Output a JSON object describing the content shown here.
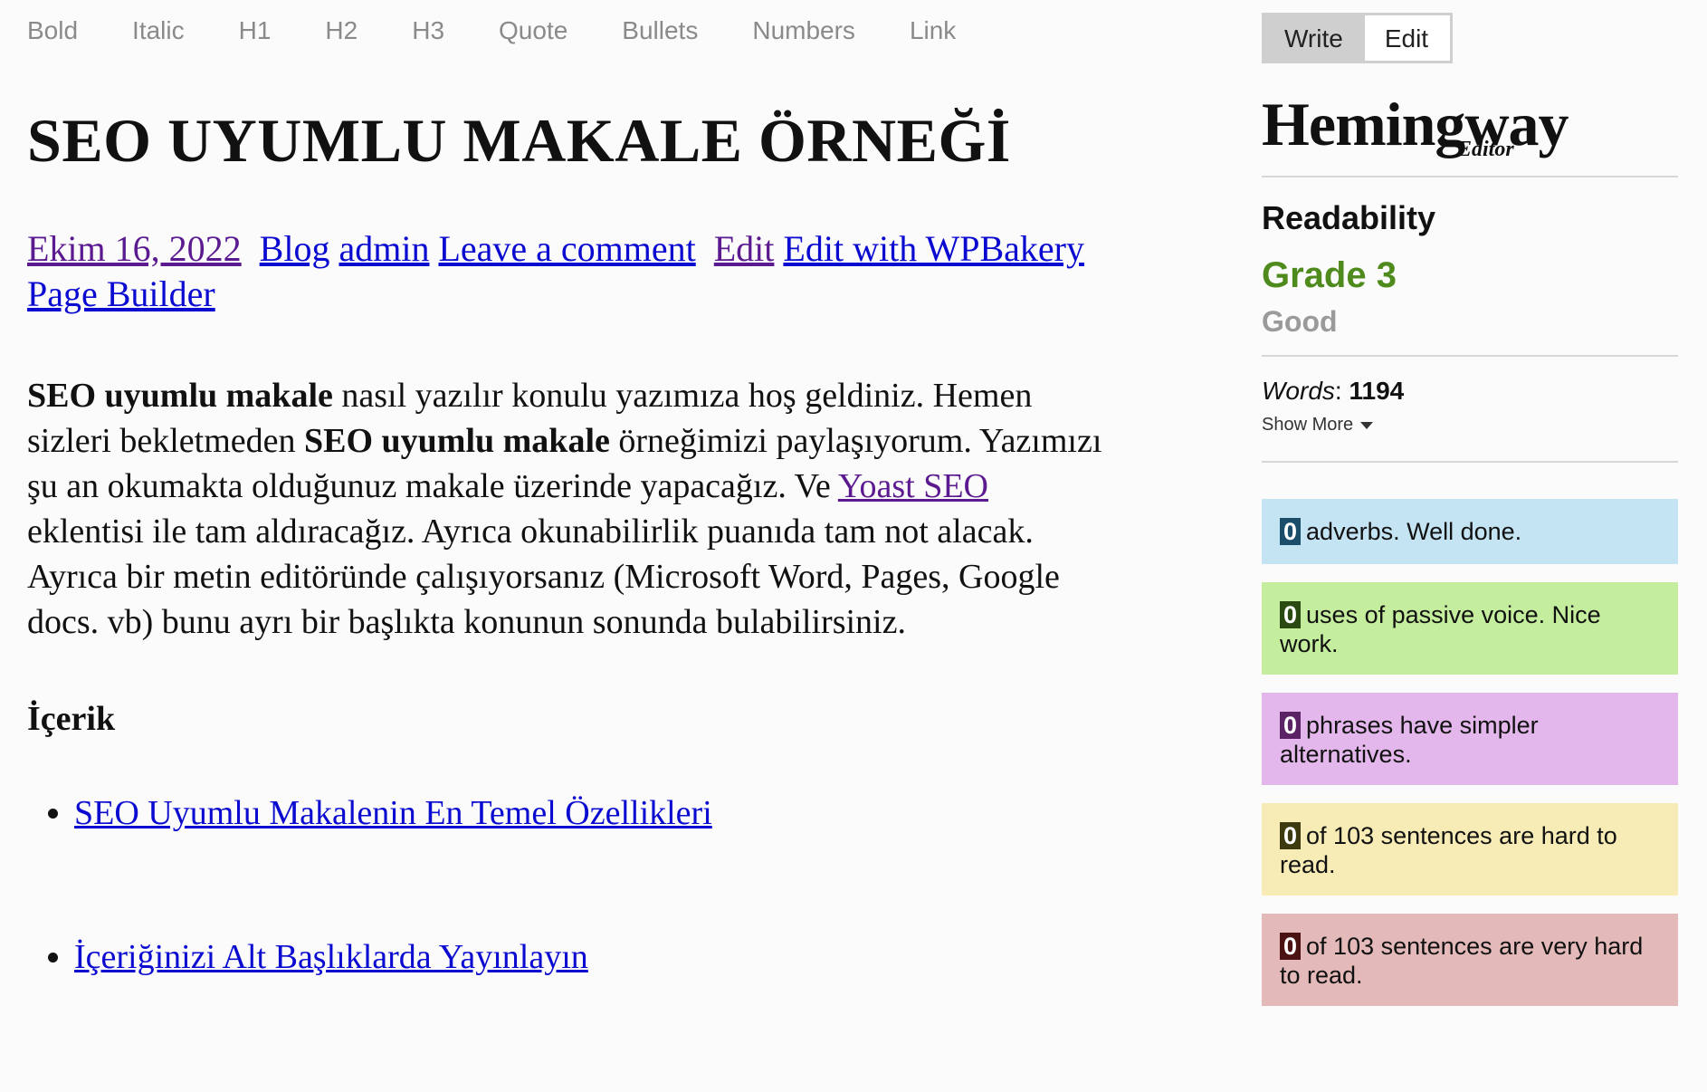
{
  "toolbar": {
    "items": [
      "Bold",
      "Italic",
      "H1",
      "H2",
      "H3",
      "Quote",
      "Bullets",
      "Numbers",
      "Link"
    ]
  },
  "article": {
    "title": "SEO UYUMLU MAKALE ÖRNEĞİ",
    "meta": {
      "date": "Ekim 16, 2022",
      "category": "Blog",
      "author": "admin",
      "comment": "Leave a comment",
      "edit": "Edit",
      "edit_with_1": "Edit with ",
      "edit_with_2": "WPBakery Page Builder"
    },
    "para": {
      "b1": "SEO uyumlu makale",
      "t1": " nasıl yazılır konulu yazımıza hoş geldiniz. Hemen sizleri bekletmeden ",
      "b2": "SEO uyumlu makale",
      "t2": " örneğimizi paylaşıyorum. Yazımızı şu an okumakta olduğunuz makale üzerinde yapacağız. Ve ",
      "link": "Yoast SEO",
      "t3": " eklentisi ile tam aldıracağız. Ayrıca okunabilirlik puanıda tam not alacak. Ayrıca bir metin editöründe çalışıyorsanız (Microsoft Word, Pages, Google docs. vb) bunu ayrı bir başlıkta konunun sonunda bulabilirsiniz."
    },
    "toc_heading": "İçerik",
    "toc": [
      "SEO Uyumlu Makalenin En Temel Özellikleri",
      "İçeriğinizi Alt Başlıklarda Yayınlayın"
    ]
  },
  "sidebar": {
    "mode": {
      "write": "Write",
      "edit": "Edit",
      "active": "edit"
    },
    "logo": {
      "main": "Hemingway",
      "small": "Editor"
    },
    "readability_label": "Readability",
    "grade": "Grade 3",
    "grade_word": "Good",
    "words_label": "Words",
    "words_value": "1194",
    "show_more": "Show More",
    "cards": {
      "adverbs": {
        "count": "0",
        "text": "adverbs. Well done."
      },
      "passive": {
        "count": "0",
        "text": "uses of passive voice. Nice work."
      },
      "simpler": {
        "count": "0",
        "text": "phrases have simpler alternatives."
      },
      "hard": {
        "count": "0",
        "text": "of 103 sentences are hard to read."
      },
      "very_hard": {
        "count": "0",
        "text": "of 103 sentences are very hard to read."
      }
    },
    "colors": {
      "grade": "#4f8a1c",
      "adverbs": "#c4e3f3",
      "passive": "#c4ed9d",
      "simpler": "#e3b7eb",
      "hard": "#f7ecb5",
      "very_hard": "#e4b9b9"
    }
  }
}
